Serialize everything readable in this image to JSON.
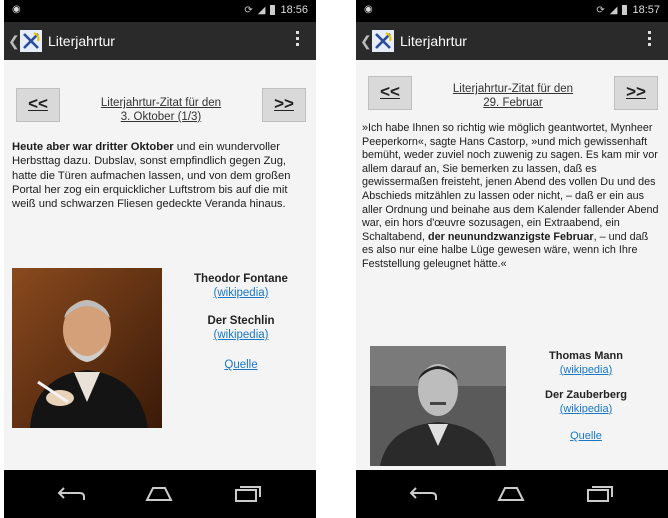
{
  "left": {
    "status": {
      "time": "18:56"
    },
    "app_title": "Literjahrtur",
    "prev_label": "<<",
    "next_label": ">>",
    "citation_title_line1": "Literjahrtur-Zitat für den",
    "citation_title_line2": "3. Oktober (1/3)",
    "quote_bold": "Heute aber war dritter Oktober",
    "quote_rest": " und ein wundervoller Herbsttag dazu. Dubslav, sonst empfindlich gegen Zug, hatte die Türen aufmachen lassen, und von dem großen Portal her zog ein erquicklicher Luftstrom bis auf die mit weiß und schwarzen Fliesen gedeckte Veranda hinaus.",
    "author": "Theodor Fontane",
    "author_link": "(wikipedia)",
    "book": "Der Stechlin",
    "book_link": "(wikipedia)",
    "source_link": "Quelle"
  },
  "right": {
    "status": {
      "time": "18:57"
    },
    "app_title": "Literjahrtur",
    "prev_label": "<<",
    "next_label": ">>",
    "citation_title_line1": "Literjahrtur-Zitat für den",
    "citation_title_line2": "29. Februar",
    "quote_part1": "»Ich habe Ihnen so richtig wie möglich geantwortet, Myn­heer Peeperkorn«, sagte Hans Castorp, »und mich gewissenhaft bemüht, weder zuviel noch zuwenig zu sagen. Es kam mir vor allem darauf an, Sie bemerken zu lassen, daß es gewissermaßen freisteht, jenen Abend des vollen Du und des Abschieds mitzählen zu lassen oder nicht, – daß er ein aus aller Ordnung und beinahe aus dem Kalender fallender Abend war, ein hors d'œuvre sozusagen, ein Extraabend, ein Schaltabend, ",
    "quote_bold": "der neunundzwanzigste Februar",
    "quote_part2": ", – und daß es also nur eine halbe Lüge gewesen wäre, wenn ich Ihre Feststellung geleugnet hätte.«",
    "author": "Thomas Mann",
    "author_link": "(wikipedia)",
    "book": "Der Zauberberg",
    "book_link": "(wikipedia)",
    "source_link": "Quelle"
  },
  "icons": {
    "left_status": "notification-icon",
    "sync": "sync-icon",
    "signal": "signal-icon",
    "battery": "battery-icon",
    "nav_back": "back-icon",
    "nav_home": "home-icon",
    "nav_recents": "recents-icon",
    "overflow": "overflow-menu-icon"
  },
  "colors": {
    "action_bar": "#2a2a2a",
    "status_bar": "#000000",
    "link": "#1a78c2",
    "nav_button": "#d9d9d9"
  }
}
